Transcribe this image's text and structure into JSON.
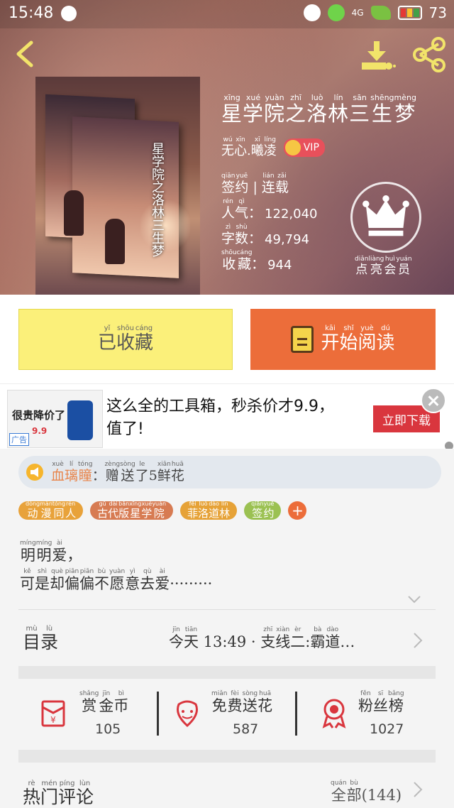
{
  "status_bar": {
    "time": "15:48",
    "network": "4G",
    "battery": "73"
  },
  "book": {
    "title": [
      [
        "星",
        "xīng"
      ],
      [
        "学",
        "xué"
      ],
      [
        "院",
        "yuàn"
      ],
      [
        "之",
        "zhī"
      ],
      [
        "洛",
        "luò"
      ],
      [
        "林",
        "lín"
      ],
      [
        "三",
        "sān"
      ],
      [
        "生",
        "shēng"
      ],
      [
        "梦",
        "mèng"
      ]
    ],
    "author": [
      [
        "无",
        "wú"
      ],
      [
        "心",
        "xīn"
      ],
      [
        ".",
        ""
      ],
      [
        "曦",
        "xī"
      ],
      [
        "凌",
        "líng"
      ]
    ],
    "vip_label": "VIP",
    "contract_status": [
      [
        "签",
        "qiān"
      ],
      [
        "约",
        "yuē"
      ],
      [
        " | ",
        ""
      ],
      [
        "连",
        "lián"
      ],
      [
        "载",
        "zǎi"
      ]
    ],
    "popularity_label": [
      [
        "人",
        "rén"
      ],
      [
        "气",
        "qì"
      ],
      [
        "：",
        ""
      ]
    ],
    "popularity_value": "122,040",
    "word_count_label": [
      [
        "字",
        "zì"
      ],
      [
        "数",
        "shù"
      ],
      [
        "：",
        ""
      ]
    ],
    "word_count_value": "49,794",
    "favorites_label": [
      [
        "收",
        "shōu"
      ],
      [
        "藏",
        "cáng"
      ],
      [
        "：",
        ""
      ]
    ],
    "favorites_value": "944",
    "cover_title": "星学院之洛林三生梦",
    "vip_member_label": [
      [
        "点",
        "diǎn"
      ],
      [
        "亮",
        "liàng"
      ],
      [
        "会",
        "huì"
      ],
      [
        "员",
        "yuán"
      ]
    ]
  },
  "actions": {
    "collected": [
      [
        "已",
        "yǐ"
      ],
      [
        "收",
        "shōu"
      ],
      [
        "藏",
        "cáng"
      ]
    ],
    "start_reading": [
      [
        "开",
        "kāi"
      ],
      [
        "始",
        "shǐ"
      ],
      [
        "阅",
        "yuè"
      ],
      [
        "读",
        "dú"
      ]
    ]
  },
  "ad": {
    "thumb_text": "很贵降价了",
    "thumb_price": "9.9",
    "thumb_tag": "广告",
    "text": "这么全的工具箱，秒杀价才9.9，值了!",
    "button": "立即下载"
  },
  "gift": {
    "user": [
      [
        "血",
        "xuè"
      ],
      [
        "璃",
        "lí"
      ],
      [
        "瞳",
        "tóng"
      ]
    ],
    "message": [
      [
        "：",
        ""
      ],
      [
        "赠",
        "zèng"
      ],
      [
        "送",
        "sòng"
      ],
      [
        "了",
        "le"
      ],
      [
        "5",
        ""
      ],
      [
        "鲜",
        "xiān"
      ],
      [
        "花",
        "huā"
      ]
    ]
  },
  "tags": [
    {
      "chars": [
        [
          "动",
          "dòng"
        ],
        [
          "漫",
          "màn"
        ],
        [
          "同",
          "tóng"
        ],
        [
          "人",
          "rén"
        ]
      ],
      "color": "#e8a23a"
    },
    {
      "chars": [
        [
          "古",
          "gǔ"
        ],
        [
          "代",
          "dài"
        ],
        [
          "版",
          "bǎn"
        ],
        [
          "星",
          "xīng"
        ],
        [
          "学",
          "xué"
        ],
        [
          "院",
          "yuàn"
        ]
      ],
      "color": "#d77b52"
    },
    {
      "chars": [
        [
          "菲",
          "fēi"
        ],
        [
          "洛",
          "luò"
        ],
        [
          "道",
          "dào"
        ],
        [
          "林",
          "lín"
        ]
      ],
      "color": "#e6a237"
    },
    {
      "chars": [
        [
          "签",
          "qiān"
        ],
        [
          "约",
          "yuē"
        ]
      ],
      "color": "#9bc152"
    }
  ],
  "description": {
    "line1": [
      [
        "明",
        "míng"
      ],
      [
        "明",
        "míng"
      ],
      [
        "爱",
        "ài"
      ],
      [
        "，",
        ""
      ]
    ],
    "line2": [
      [
        "可",
        "kě"
      ],
      [
        "是",
        "shì"
      ],
      [
        "却",
        "què"
      ],
      [
        "偏",
        "piān"
      ],
      [
        "偏",
        "piān"
      ],
      [
        "不",
        "bù"
      ],
      [
        "愿",
        "yuàn"
      ],
      [
        "意",
        "yì"
      ],
      [
        "去",
        "qù"
      ],
      [
        "爱",
        "ài"
      ],
      [
        "·········",
        ""
      ]
    ]
  },
  "toc": {
    "label": [
      [
        "目",
        "mù"
      ],
      [
        "录",
        "lù"
      ]
    ],
    "latest": [
      [
        "今",
        "jīn"
      ],
      [
        "天",
        "tiān"
      ],
      [
        " 13:49 · ",
        ""
      ],
      [
        "支",
        "zhī"
      ],
      [
        "线",
        "xiàn"
      ],
      [
        "二",
        "èr"
      ],
      [
        ":",
        ""
      ],
      [
        "霸",
        "bà"
      ],
      [
        "道",
        "dào"
      ],
      [
        "…",
        ""
      ]
    ]
  },
  "stats": [
    {
      "label": [
        [
          "赏",
          "shǎng"
        ],
        [
          "金",
          "jīn"
        ],
        [
          "币",
          "bì"
        ]
      ],
      "value": "105",
      "icon": "red-envelope-icon"
    },
    {
      "label": [
        [
          "免",
          "miǎn"
        ],
        [
          "费",
          "fèi"
        ],
        [
          "送",
          "sòng"
        ],
        [
          "花",
          "huā"
        ]
      ],
      "value": "587",
      "icon": "flower-icon"
    },
    {
      "label": [
        [
          "粉",
          "fěn"
        ],
        [
          "丝",
          "sī"
        ],
        [
          "榜",
          "bǎng"
        ]
      ],
      "value": "1027",
      "icon": "medal-icon"
    }
  ],
  "comments": {
    "label": [
      [
        "热",
        "rè"
      ],
      [
        "门",
        "mén"
      ],
      [
        "评",
        "píng"
      ],
      [
        "论",
        "lùn"
      ]
    ],
    "all": [
      [
        "全",
        "quán"
      ],
      [
        "部",
        "bù"
      ],
      [
        "(144)",
        ""
      ]
    ]
  },
  "colors": {
    "accent_orange": "#ec6d3a",
    "collect_yellow": "#fbf07a",
    "icon_red": "#d9363e",
    "gift_user": "#e8844a"
  }
}
